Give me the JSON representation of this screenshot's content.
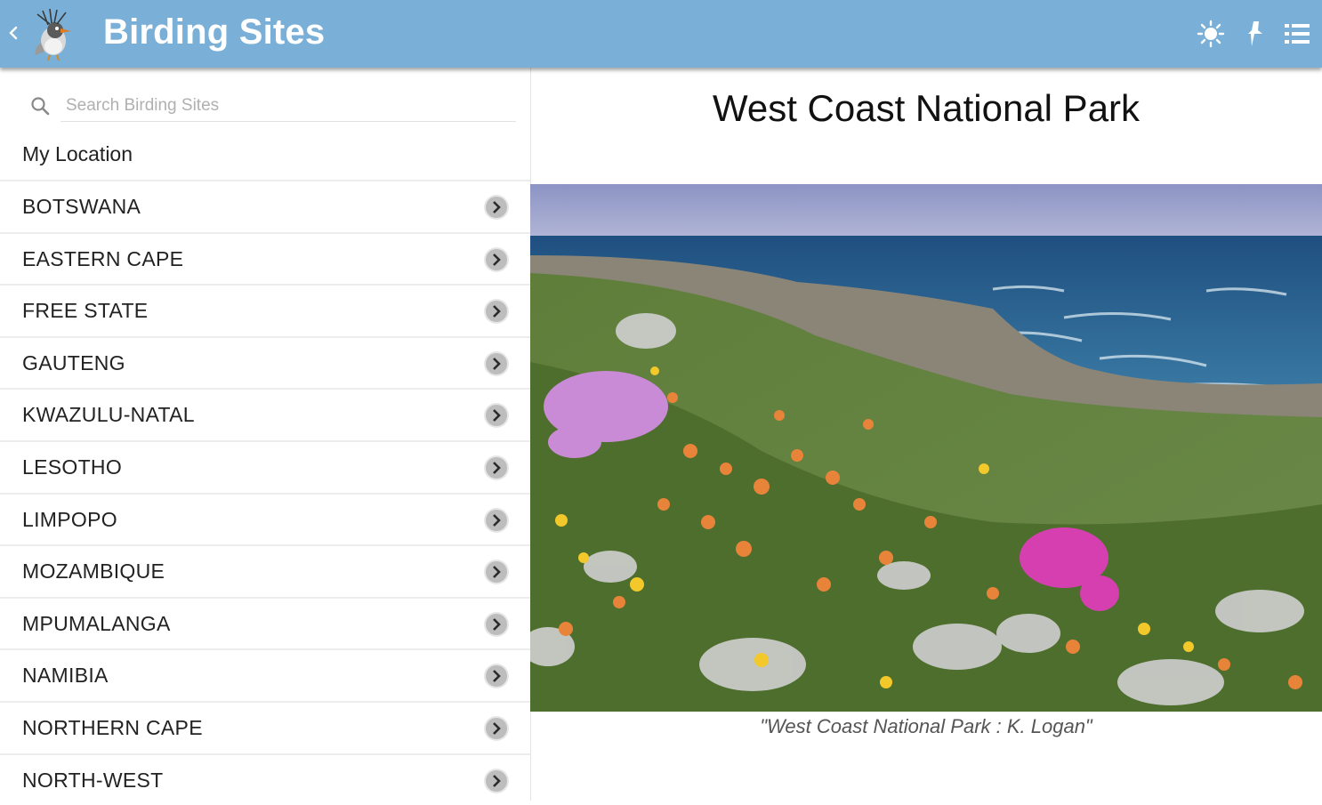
{
  "app": {
    "title": "Birding Sites"
  },
  "toolbar": {
    "back_icon": "chevron-left-icon",
    "logo_icon": "bird-logo-icon",
    "actions": [
      "brightness-icon",
      "map-pin-icon",
      "list-icon"
    ]
  },
  "search": {
    "placeholder": "Search Birding Sites",
    "value": ""
  },
  "sidebar": {
    "my_location": "My Location",
    "items": [
      {
        "label": "BOTSWANA"
      },
      {
        "label": "EASTERN CAPE"
      },
      {
        "label": "FREE STATE"
      },
      {
        "label": "GAUTENG"
      },
      {
        "label": "KWAZULU-NATAL"
      },
      {
        "label": "LESOTHO"
      },
      {
        "label": "LIMPOPO"
      },
      {
        "label": "MOZAMBIQUE"
      },
      {
        "label": "MPUMALANGA"
      },
      {
        "label": "NAMIBIA"
      },
      {
        "label": "NORTHERN CAPE"
      },
      {
        "label": "NORTH-WEST"
      }
    ]
  },
  "main": {
    "title": "West Coast National Park",
    "caption": "\"West Coast National Park : K. Logan\""
  },
  "colors": {
    "appbar": "#7ab0d8",
    "chevron_button": "#8a8a8a"
  }
}
